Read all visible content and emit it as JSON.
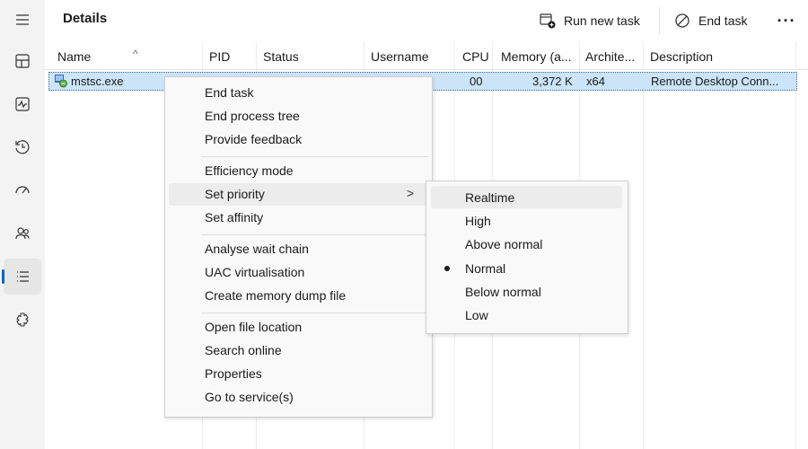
{
  "header": {
    "title": "Details",
    "run_new_task": "Run new task",
    "end_task": "End task",
    "more": "···"
  },
  "sidebar": {
    "items": [
      {
        "icon": "hamburger-icon"
      },
      {
        "icon": "processes-icon"
      },
      {
        "icon": "performance-icon"
      },
      {
        "icon": "app-history-icon"
      },
      {
        "icon": "startup-apps-icon"
      },
      {
        "icon": "users-icon"
      },
      {
        "icon": "details-icon",
        "active": true
      },
      {
        "icon": "services-icon"
      }
    ]
  },
  "table": {
    "columns": [
      "Name",
      "PID",
      "Status",
      "Username",
      "CPU",
      "Memory (a...",
      "Archite...",
      "Description"
    ],
    "row": {
      "name": "mstsc.exe",
      "pid": "",
      "status": "",
      "username": "",
      "cpu": "00",
      "memory": "3,372 K",
      "architecture": "x64",
      "description": "Remote Desktop Conn..."
    }
  },
  "context_menu": {
    "groups": [
      [
        "End task",
        "End process tree",
        "Provide feedback"
      ],
      [
        "Efficiency mode",
        "Set priority",
        "Set affinity"
      ],
      [
        "Analyse wait chain",
        "UAC virtualisation",
        "Create memory dump file"
      ],
      [
        "Open file location",
        "Search online",
        "Properties",
        "Go to service(s)"
      ]
    ],
    "highlighted": "Set priority",
    "submenu_chevron": ">"
  },
  "priority_submenu": {
    "items": [
      "Realtime",
      "High",
      "Above normal",
      "Normal",
      "Below normal",
      "Low"
    ],
    "selected": "Normal",
    "highlighted": "Realtime"
  },
  "colors": {
    "accent": "#0067c0",
    "selection": "#cce4f7"
  }
}
